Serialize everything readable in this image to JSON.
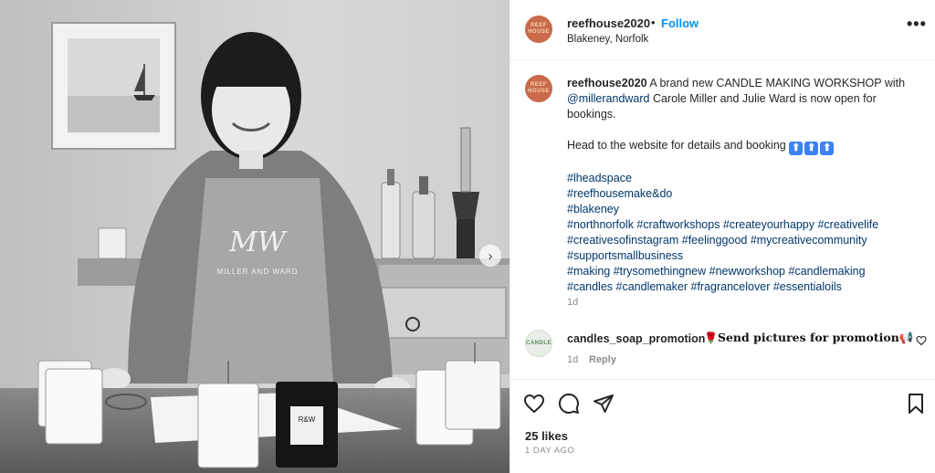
{
  "post": {
    "username": "reefhouse2020",
    "separator": "•",
    "follow_label": "Follow",
    "location": "Blakeney, Norfolk",
    "more_label": "•••",
    "avatar_text": "REEF HOUSE"
  },
  "photo": {
    "apron_logo": "MW",
    "apron_text": "MILLER AND WARD",
    "jar_label": "R&W",
    "next_label": "›"
  },
  "caption": {
    "username": "reefhouse2020",
    "text_1": " A brand new CANDLE MAKING WORKSHOP with ",
    "mention": "@millerandward",
    "text_2": " Carole Miller and Julie Ward is now open for bookings.",
    "text_3": "Head to the website for details and booking ",
    "emoji": "⬆",
    "hashtag_lines": [
      "#lheadspace",
      "#reefhousemake&do",
      "#blakeney",
      "#northnorfolk #craftworkshops #createyourhappy #creativelife",
      "#creativesofinstagram #feelinggood #mycreativecommunity",
      "#supportsmallbusiness",
      "#making #trysomethingnew #newworkshop #candlemaking",
      "#candles #candlemaker #fragrancelover #essentialoils"
    ],
    "time": "1d"
  },
  "comment": {
    "username": "candles_soap_promotion",
    "rose": "🌹",
    "text": "Send pictures for promotion",
    "megaphone": "📢",
    "time": "1d",
    "reply_label": "Reply",
    "avatar_text": "CANDLE"
  },
  "footer": {
    "likes": "25 likes",
    "date": "1 DAY AGO"
  },
  "icons": [
    "heart-icon",
    "comment-icon",
    "share-icon",
    "bookmark-icon",
    "more-icon",
    "chevron-right-icon"
  ],
  "colors": {
    "link": "#0095f6",
    "hashtag": "#00376b",
    "meta": "#8e8e8e",
    "avatar": "#c96a4a"
  }
}
